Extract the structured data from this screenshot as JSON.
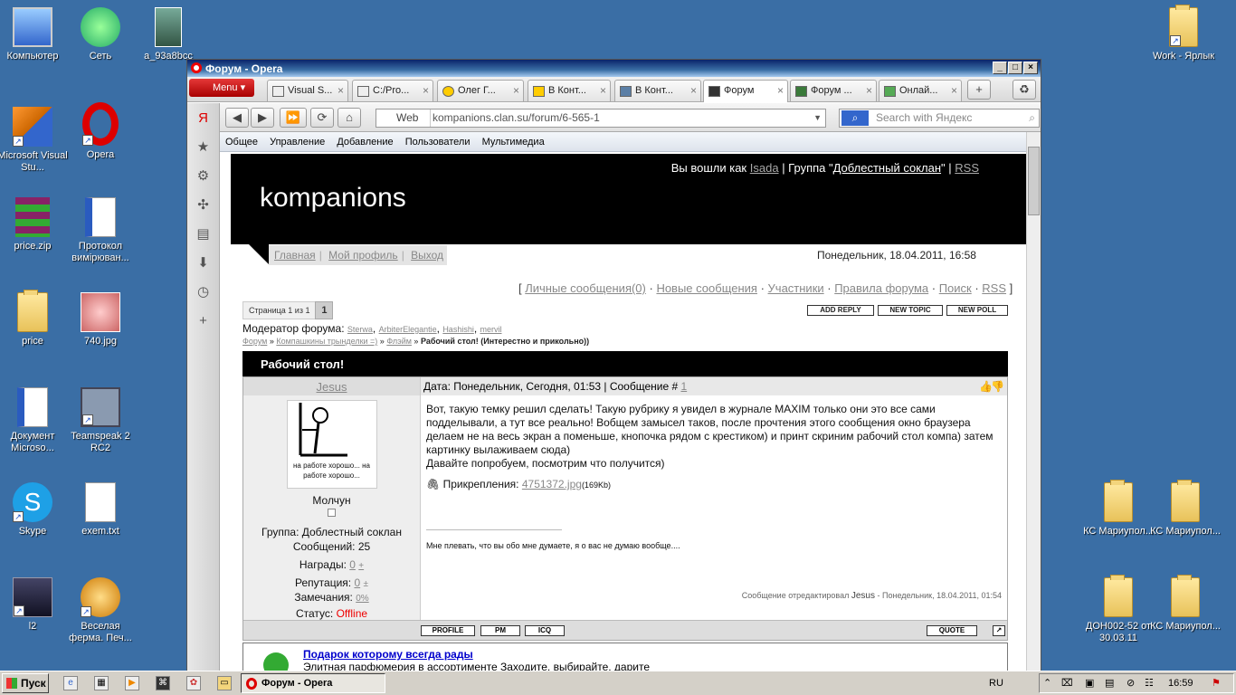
{
  "desktop": {
    "icons": [
      {
        "label": "Компьютер",
        "icon": "computer-icon"
      },
      {
        "label": "Сеть",
        "icon": "network-icon"
      },
      {
        "label": "a_93a8bcc",
        "icon": "image-icon"
      },
      {
        "label": "Work - Ярлык",
        "icon": "folder-shortcut-icon"
      },
      {
        "label": "Microsoft Visual Stu...",
        "icon": "visual-studio-icon"
      },
      {
        "label": "Opera",
        "icon": "opera-icon"
      },
      {
        "label": "price.zip",
        "icon": "archive-icon"
      },
      {
        "label": "Протокол вимірюван...",
        "icon": "word-doc-icon"
      },
      {
        "label": "price",
        "icon": "folder-icon"
      },
      {
        "label": "740.jpg",
        "icon": "image-icon"
      },
      {
        "label": "Документ Microso...",
        "icon": "word-doc-icon"
      },
      {
        "label": "Teamspeak 2 RC2",
        "icon": "teamspeak-icon"
      },
      {
        "label": "Skype",
        "icon": "skype-icon"
      },
      {
        "label": "exem.txt",
        "icon": "text-file-icon"
      },
      {
        "label": "l2",
        "icon": "game-icon"
      },
      {
        "label": "Веселая ферма. Печ...",
        "icon": "game-icon"
      },
      {
        "label": "КС Мариупол...",
        "icon": "folder-icon"
      },
      {
        "label": "КС Мариупол...",
        "icon": "folder-icon"
      },
      {
        "label": "ДОН002-52 от 30.03.11",
        "icon": "folder-icon"
      },
      {
        "label": "КС Мариупол...",
        "icon": "folder-icon"
      }
    ]
  },
  "window": {
    "title": "Форум - Opera",
    "menu_label": "Menu",
    "tabs": [
      {
        "label": "Visual S..."
      },
      {
        "label": "C:/Pro..."
      },
      {
        "label": "Олег Г..."
      },
      {
        "label": "В Конт..."
      },
      {
        "label": "В Конт..."
      },
      {
        "label": "Форум"
      },
      {
        "label": "Форум ..."
      },
      {
        "label": "Онлай..."
      }
    ],
    "address": {
      "mode": "Web",
      "url": "kompanions.clan.su/forum/6-565-1"
    },
    "search": {
      "placeholder": "Search with Яндекс"
    }
  },
  "ucozbar": {
    "items": [
      "Общее",
      "Управление",
      "Добавление",
      "Пользователи",
      "Мультимедиа"
    ]
  },
  "site": {
    "logged_as_prefix": "Вы вошли как",
    "user": "Isada",
    "group_prefix": "| Группа \"",
    "group": "Доблестный соклан",
    "group_suffix": "\" |",
    "rss": "RSS",
    "title": "kompanions",
    "nav": [
      "Главная",
      "Мой профиль",
      "Выход"
    ],
    "datetime": "Понедельник, 18.04.2011, 16:58"
  },
  "forum": {
    "toplinks": [
      "Личные сообщения(0)",
      "Новые сообщения",
      "Участники",
      "Правила форума",
      "Поиск",
      "RSS"
    ],
    "pager": {
      "text": "Страница 1 из 1",
      "page": "1"
    },
    "buttons": [
      "ADD REPLY",
      "NEW TOPIC",
      "NEW POLL"
    ],
    "moderators_label": "Модератор форума:",
    "moderators": [
      "Sterwa",
      "ArbiterElegantie",
      "Hashishi",
      "mervil"
    ],
    "breadcrumbs": [
      "Форум",
      "Компашкины трынделки =)",
      "Флэйм"
    ],
    "breadcrumb_current": "Рабочий стол! (Интерестно и прикольно))",
    "topic_title": "Рабочий стол!"
  },
  "post": {
    "author": "Jesus",
    "avatar_caption": "на работе хорошо... на работе хорошо...",
    "rank": "Молчун",
    "group": "Группа: Доблестный соклан",
    "messages": "Сообщений: 25",
    "awards_label": "Награды:",
    "awards": "0",
    "rep_label": "Репутация:",
    "rep": "0",
    "warnings_label": "Замечания:",
    "warnings": "0%",
    "status_label": "Статус:",
    "status": "Offline",
    "header": "Дата: Понедельник, Сегодня, 01:53 | Сообщение #",
    "number": "1",
    "body_1": "Вот, такую темку решил сделать! Такую рубрику я увидел в журнале MAXIM только они это все сами подделывали, а тут все реально! Вобщем замысел таков, после прочтения этого сообщения окно браузера делаем не на весь экран а поменьше, кнопочка рядом с крестиком) и принт скриним рабочий стол компа) затем картинку вылаживаем сюда)",
    "body_2": "Давайте попробуем, посмотрим что получится)",
    "attach_label": "Прикрепления:",
    "attach_file": "4751372.jpg",
    "attach_size": "(169Kb)",
    "signature": "Мне плевать, что вы обо мне думаете, я о вас не думаю вообще....",
    "edited_prefix": "Сообщение отредактировал",
    "edited_by": "Jesus",
    "edited_when": "- Понедельник, 18.04.2011, 01:54",
    "buttons": [
      "PROFILE",
      "PM",
      "ICQ",
      "QUOTE"
    ]
  },
  "ad": {
    "title": "Подарок которому всегда рады",
    "text": "Элитная парфюмерия в ассортименте Заходите, выбирайте, дарите"
  },
  "taskbar": {
    "start": "Пуск",
    "task": "Форум - Opera",
    "lang": "RU",
    "clock": "16:59"
  }
}
